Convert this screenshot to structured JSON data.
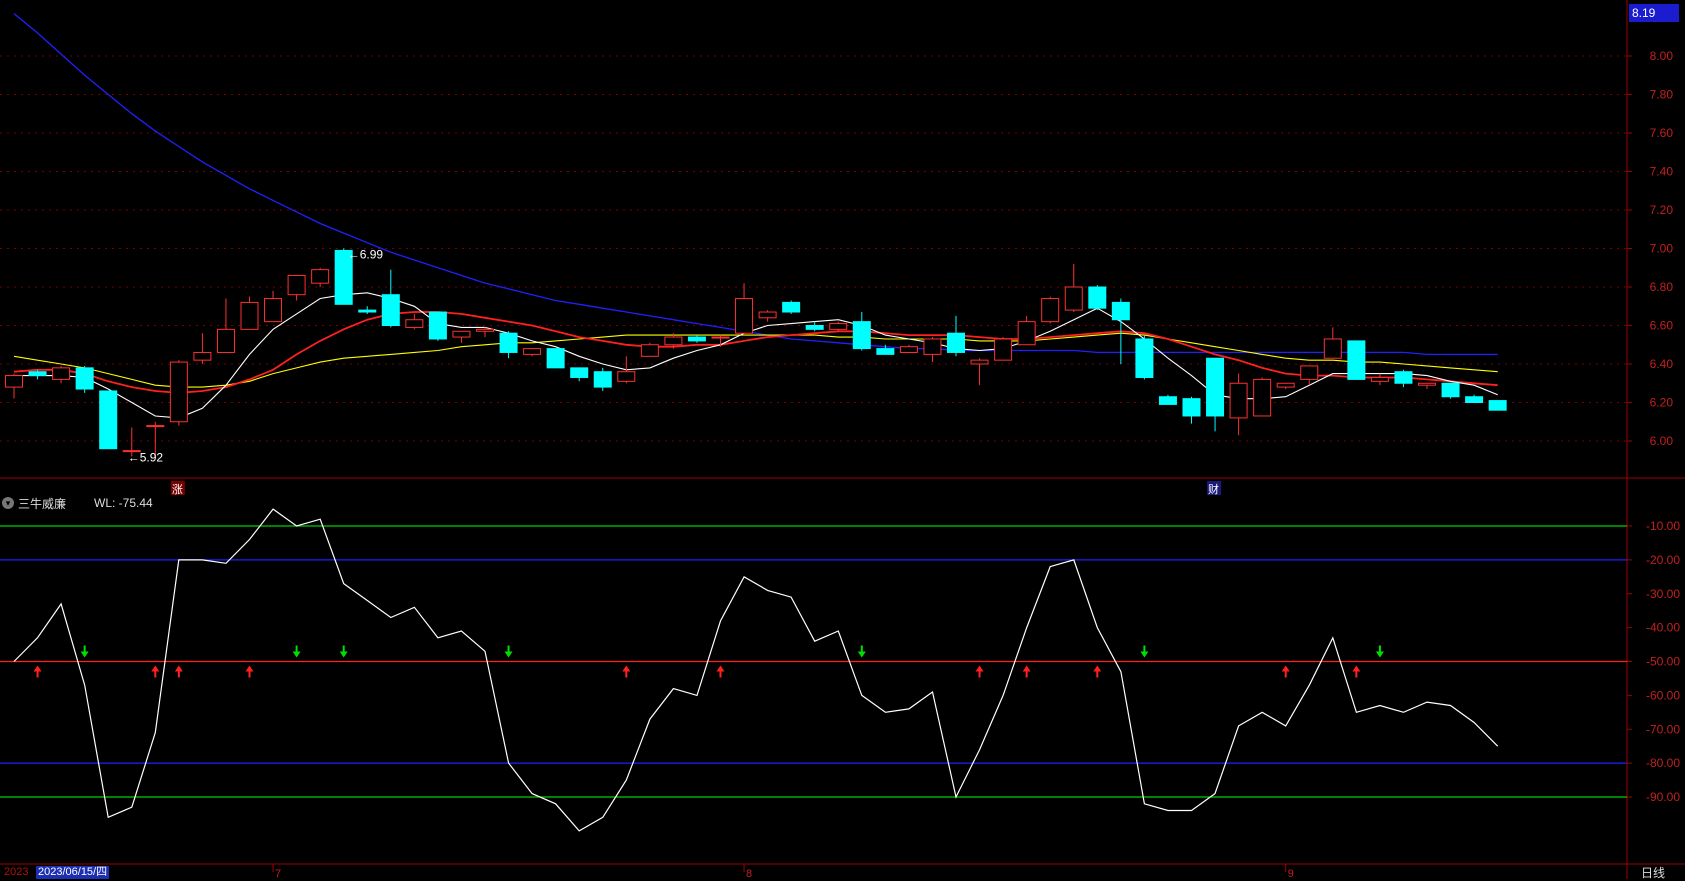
{
  "price_badge": "8.19",
  "period_label": "日线",
  "indicator": {
    "name": "三牛威廉",
    "value_text": "WL: -75.44"
  },
  "date_badge": "2023/06/15/四",
  "date_badge_prefix": "2023",
  "month_labels": [
    "7",
    "8",
    "9"
  ],
  "markers": {
    "low_label": "5.92",
    "high_label": "6.99",
    "zhang": "涨",
    "cai": "财"
  },
  "colors": {
    "up": "#ff3030",
    "down": "#00ffff",
    "ma5": "#ffffff",
    "ma10": "#ffff00",
    "ma20": "#ff2020",
    "ma60": "#2020ff",
    "grid": "#7a0000",
    "axis_text": "#c02020"
  },
  "chart_data": [
    {
      "type": "candlestick",
      "ylim": [
        5.82,
        8.22
      ],
      "ytick_labels": [
        "6.00",
        "6.20",
        "6.40",
        "6.60",
        "6.80",
        "7.00",
        "7.20",
        "7.40",
        "7.60",
        "7.80",
        "8.00"
      ],
      "ohlc": [
        [
          6.28,
          6.35,
          6.22,
          6.34
        ],
        [
          6.36,
          6.37,
          6.32,
          6.34
        ],
        [
          6.32,
          6.39,
          6.3,
          6.38
        ],
        [
          6.38,
          6.39,
          6.25,
          6.27
        ],
        [
          6.26,
          6.26,
          5.96,
          5.96
        ],
        [
          5.95,
          6.07,
          5.92,
          5.95
        ],
        [
          6.08,
          6.1,
          5.92,
          6.08
        ],
        [
          6.1,
          6.42,
          6.08,
          6.41
        ],
        [
          6.42,
          6.56,
          6.4,
          6.46
        ],
        [
          6.46,
          6.74,
          6.46,
          6.58
        ],
        [
          6.58,
          6.75,
          6.58,
          6.72
        ],
        [
          6.62,
          6.78,
          6.62,
          6.74
        ],
        [
          6.76,
          6.86,
          6.73,
          6.86
        ],
        [
          6.82,
          6.9,
          6.8,
          6.89
        ],
        [
          6.99,
          7.0,
          6.71,
          6.71
        ],
        [
          6.68,
          6.7,
          6.66,
          6.67
        ],
        [
          6.76,
          6.89,
          6.59,
          6.6
        ],
        [
          6.59,
          6.66,
          6.58,
          6.63
        ],
        [
          6.67,
          6.67,
          6.52,
          6.53
        ],
        [
          6.54,
          6.57,
          6.51,
          6.57
        ],
        [
          6.57,
          6.59,
          6.54,
          6.58
        ],
        [
          6.56,
          6.57,
          6.43,
          6.46
        ],
        [
          6.45,
          6.48,
          6.44,
          6.48
        ],
        [
          6.48,
          6.48,
          6.38,
          6.38
        ],
        [
          6.38,
          6.38,
          6.31,
          6.33
        ],
        [
          6.36,
          6.38,
          6.26,
          6.28
        ],
        [
          6.31,
          6.44,
          6.3,
          6.36
        ],
        [
          6.44,
          6.51,
          6.44,
          6.5
        ],
        [
          6.5,
          6.56,
          6.48,
          6.54
        ],
        [
          6.54,
          6.55,
          6.51,
          6.52
        ],
        [
          6.54,
          6.55,
          6.49,
          6.54
        ],
        [
          6.56,
          6.82,
          6.55,
          6.74
        ],
        [
          6.64,
          6.68,
          6.62,
          6.67
        ],
        [
          6.72,
          6.73,
          6.66,
          6.67
        ],
        [
          6.6,
          6.62,
          6.57,
          6.58
        ],
        [
          6.58,
          6.62,
          6.57,
          6.61
        ],
        [
          6.62,
          6.67,
          6.47,
          6.48
        ],
        [
          6.48,
          6.5,
          6.45,
          6.45
        ],
        [
          6.46,
          6.5,
          6.46,
          6.49
        ],
        [
          6.45,
          6.54,
          6.41,
          6.53
        ],
        [
          6.56,
          6.65,
          6.44,
          6.46
        ],
        [
          6.4,
          6.43,
          6.29,
          6.42
        ],
        [
          6.42,
          6.54,
          6.42,
          6.53
        ],
        [
          6.5,
          6.65,
          6.5,
          6.62
        ],
        [
          6.62,
          6.75,
          6.61,
          6.74
        ],
        [
          6.68,
          6.92,
          6.67,
          6.8
        ],
        [
          6.8,
          6.81,
          6.68,
          6.69
        ],
        [
          6.72,
          6.74,
          6.4,
          6.63
        ],
        [
          6.53,
          6.55,
          6.32,
          6.33
        ],
        [
          6.23,
          6.24,
          6.19,
          6.19
        ],
        [
          6.22,
          6.23,
          6.09,
          6.13
        ],
        [
          6.43,
          6.43,
          6.05,
          6.13
        ],
        [
          6.12,
          6.35,
          6.03,
          6.3
        ],
        [
          6.13,
          6.33,
          6.13,
          6.32
        ],
        [
          6.28,
          6.3,
          6.27,
          6.3
        ],
        [
          6.32,
          6.39,
          6.29,
          6.39
        ],
        [
          6.43,
          6.59,
          6.43,
          6.53
        ],
        [
          6.52,
          6.52,
          6.32,
          6.32
        ],
        [
          6.31,
          6.35,
          6.29,
          6.33
        ],
        [
          6.36,
          6.37,
          6.28,
          6.3
        ],
        [
          6.29,
          6.3,
          6.27,
          6.3
        ],
        [
          6.3,
          6.3,
          6.22,
          6.23
        ],
        [
          6.23,
          6.24,
          6.2,
          6.2
        ],
        [
          6.21,
          6.21,
          6.16,
          6.16
        ]
      ],
      "ma5": [
        6.34,
        6.34,
        6.34,
        6.33,
        6.27,
        6.2,
        6.13,
        6.12,
        6.17,
        6.29,
        6.45,
        6.58,
        6.66,
        6.74,
        6.76,
        6.77,
        6.74,
        6.7,
        6.61,
        6.59,
        6.59,
        6.56,
        6.52,
        6.49,
        6.44,
        6.4,
        6.37,
        6.38,
        6.43,
        6.47,
        6.5,
        6.56,
        6.6,
        6.61,
        6.62,
        6.63,
        6.6,
        6.55,
        6.53,
        6.51,
        6.48,
        6.47,
        6.48,
        6.52,
        6.57,
        6.63,
        6.69,
        6.62,
        6.53,
        6.43,
        6.34,
        6.24,
        6.22,
        6.22,
        6.23,
        6.29,
        6.35,
        6.35,
        6.35,
        6.35,
        6.34,
        6.31,
        6.29,
        6.24
      ],
      "ma10": [
        6.44,
        6.42,
        6.4,
        6.38,
        6.35,
        6.32,
        6.29,
        6.28,
        6.28,
        6.29,
        6.31,
        6.35,
        6.38,
        6.41,
        6.43,
        6.44,
        6.45,
        6.46,
        6.47,
        6.49,
        6.5,
        6.51,
        6.51,
        6.52,
        6.53,
        6.54,
        6.55,
        6.55,
        6.55,
        6.55,
        6.55,
        6.55,
        6.55,
        6.55,
        6.55,
        6.54,
        6.54,
        6.53,
        6.53,
        6.53,
        6.53,
        6.52,
        6.52,
        6.52,
        6.53,
        6.54,
        6.55,
        6.56,
        6.55,
        6.53,
        6.51,
        6.49,
        6.47,
        6.45,
        6.43,
        6.42,
        6.42,
        6.41,
        6.41,
        6.4,
        6.39,
        6.38,
        6.37,
        6.36
      ],
      "ma20": [
        6.36,
        6.37,
        6.37,
        6.35,
        6.31,
        6.28,
        6.26,
        6.25,
        6.26,
        6.28,
        6.32,
        6.37,
        6.45,
        6.52,
        6.58,
        6.63,
        6.66,
        6.67,
        6.67,
        6.66,
        6.64,
        6.62,
        6.6,
        6.57,
        6.54,
        6.52,
        6.5,
        6.49,
        6.49,
        6.5,
        6.5,
        6.52,
        6.54,
        6.55,
        6.56,
        6.57,
        6.57,
        6.56,
        6.55,
        6.55,
        6.55,
        6.54,
        6.53,
        6.53,
        6.54,
        6.55,
        6.56,
        6.57,
        6.56,
        6.53,
        6.49,
        6.45,
        6.42,
        6.38,
        6.35,
        6.34,
        6.34,
        6.33,
        6.33,
        6.33,
        6.32,
        6.31,
        6.3,
        6.29
      ],
      "ma60": [
        8.22,
        8.12,
        8.01,
        7.9,
        7.8,
        7.7,
        7.61,
        7.53,
        7.45,
        7.38,
        7.31,
        7.25,
        7.19,
        7.13,
        7.08,
        7.03,
        6.98,
        6.94,
        6.9,
        6.86,
        6.82,
        6.79,
        6.76,
        6.73,
        6.71,
        6.69,
        6.67,
        6.65,
        6.63,
        6.61,
        6.59,
        6.57,
        6.55,
        6.53,
        6.52,
        6.51,
        6.5,
        6.49,
        6.48,
        6.48,
        6.47,
        6.47,
        6.47,
        6.47,
        6.47,
        6.47,
        6.46,
        6.46,
        6.46,
        6.46,
        6.46,
        6.46,
        6.46,
        6.46,
        6.46,
        6.46,
        6.46,
        6.46,
        6.46,
        6.46,
        6.45,
        6.45,
        6.45,
        6.45
      ]
    },
    {
      "type": "line",
      "name": "WL",
      "ylim": [
        -100,
        0
      ],
      "ytick_labels": [
        "-10.00",
        "-20.00",
        "-30.00",
        "-40.00",
        "-50.00",
        "-60.00",
        "-70.00",
        "-80.00",
        "-90.00"
      ],
      "reference_levels": [
        -10,
        -20,
        -50,
        -80,
        -90
      ],
      "values": [
        -50,
        -43,
        -33,
        -57,
        -96,
        -93,
        -71,
        -20,
        -20,
        -21,
        -14,
        -5,
        -10,
        -8,
        -27,
        -32,
        -37,
        -34,
        -43,
        -41,
        -47,
        -80,
        -89,
        -92,
        -100,
        -96,
        -85,
        -67,
        -58,
        -60,
        -38,
        -25,
        -29,
        -31,
        -44,
        -41,
        -60,
        -65,
        -64,
        -59,
        -90,
        -76,
        -60,
        -40,
        -22,
        -20,
        -40,
        -53,
        -92,
        -94,
        -94,
        -89,
        -69,
        -65,
        -69,
        -57,
        -43,
        -65,
        -63,
        -65,
        -62,
        -63,
        -68,
        -75
      ],
      "buy_signals": [
        1,
        6,
        7,
        10,
        26,
        30,
        41,
        43,
        46,
        54,
        57
      ],
      "sell_signals": [
        3,
        12,
        14,
        21,
        36,
        48,
        58
      ]
    }
  ]
}
